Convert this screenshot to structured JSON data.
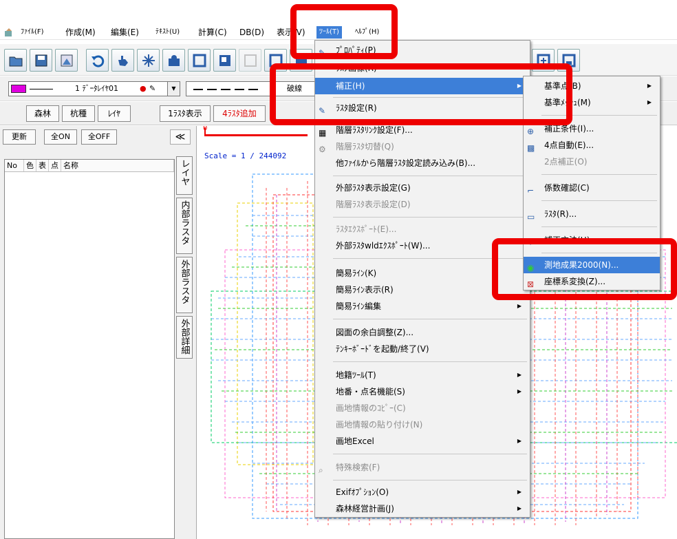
{
  "menubar": {
    "items": [
      "ﾌｧｲﾙ(F)",
      "作成(M)",
      "編集(E)",
      "ﾃｷｽﾄ(U)",
      "計算(C)",
      "DB(D)",
      "表示(V)",
      "ﾂｰﾙ(T)",
      "ﾍﾙﾌﾟ(H)"
    ]
  },
  "toolbar2": {
    "layer_combo": "1 ﾃﾞｰﾀﾚｲﾔ01",
    "linetype_combo": "破線"
  },
  "toolbar3": {
    "buttons": [
      "森林",
      "杭種",
      "ﾚｲﾔ",
      "1ﾗｽﾀ表示",
      "4ﾗｽﾀ追加"
    ]
  },
  "left_panel": {
    "buttons": [
      "更新",
      "全ON",
      "全OFF"
    ],
    "collapse_label": "≪",
    "columns": [
      "No",
      "色",
      "表",
      "点",
      "名称"
    ],
    "vertical_tabs": [
      "レイヤ",
      "内部ラスタ",
      "外部ラスタ",
      "外部詳細"
    ]
  },
  "canvas": {
    "scale_zero": "0",
    "scale_text": "Scale = 1 / 244092"
  },
  "tools_menu": {
    "items": [
      {
        "label": "ﾌﾟﾛﾊﾟﾃｨ(P)",
        "disabled": false,
        "submenu": false
      },
      {
        "label": "ﾗｽﾀ画像(R)",
        "disabled": false,
        "submenu": false
      },
      {
        "label": "補正(H)",
        "disabled": false,
        "submenu": true,
        "highlighted": true
      },
      {
        "label": "ﾗｽﾀ設定(R)",
        "disabled": false,
        "submenu": false
      },
      {
        "label": "階層ﾗｽﾀﾘﾝｸ設定(F)...",
        "disabled": false,
        "submenu": false
      },
      {
        "label": "階層ﾗｽﾀ切替(Q)",
        "disabled": true,
        "submenu": false
      },
      {
        "label": "他ﾌｧｲﾙから階層ﾗｽﾀ設定読み込み(B)...",
        "disabled": false,
        "submenu": false
      },
      {
        "label": "外部ﾗｽﾀ表示設定(G)",
        "disabled": false,
        "submenu": false
      },
      {
        "label": "階層ﾗｽﾀ表示設定(D)",
        "disabled": true,
        "submenu": false
      },
      {
        "label": "ﾗｽﾀｴｸｽﾎﾟｰﾄ(E)...",
        "disabled": true,
        "submenu": false
      },
      {
        "label": "外部ﾗｽﾀwldｴｸｽﾎﾟｰﾄ(W)...",
        "disabled": false,
        "submenu": false
      },
      {
        "label": "簡易ﾗｲﾝ(K)",
        "disabled": false,
        "submenu": false
      },
      {
        "label": "簡易ﾗｲﾝ表示(R)",
        "disabled": false,
        "submenu": false
      },
      {
        "label": "簡易ﾗｲﾝ編集",
        "disabled": false,
        "submenu": true
      },
      {
        "label": "図面の余白調整(Z)...",
        "disabled": false,
        "submenu": false
      },
      {
        "label": "ﾃﾝｷｰﾎﾞｰﾄﾞを起動/終了(V)",
        "disabled": false,
        "submenu": false
      },
      {
        "label": "地籍ﾂｰﾙ(T)",
        "disabled": false,
        "submenu": true
      },
      {
        "label": "地番・点名機能(S)",
        "disabled": false,
        "submenu": true
      },
      {
        "label": "画地情報のｺﾋﾟｰ(C)",
        "disabled": true,
        "submenu": false
      },
      {
        "label": "画地情報の貼り付け(N)",
        "disabled": true,
        "submenu": false
      },
      {
        "label": "画地Excel",
        "disabled": false,
        "submenu": true
      },
      {
        "label": "特殊検索(F)",
        "disabled": true,
        "submenu": false
      },
      {
        "label": "Exifｵﾌﾟｼｮﾝ(O)",
        "disabled": false,
        "submenu": true
      },
      {
        "label": "森林経営計画(J)",
        "disabled": false,
        "submenu": true
      }
    ]
  },
  "correction_submenu": {
    "items": [
      {
        "label": "基準点(B)",
        "disabled": false,
        "submenu": true
      },
      {
        "label": "基準ﾒｯｼｭ(M)",
        "disabled": false,
        "submenu": true
      },
      {
        "label": "補正条件(I)...",
        "disabled": false,
        "submenu": false
      },
      {
        "label": "4点自動(E)...",
        "disabled": false,
        "submenu": false
      },
      {
        "label": "2点補正(O)",
        "disabled": true,
        "submenu": false
      },
      {
        "label": "係数確認(C)",
        "disabled": false,
        "submenu": false
      },
      {
        "label": "ﾗｽﾀ(R)...",
        "disabled": false,
        "submenu": false
      },
      {
        "label": "補正方法(H)",
        "disabled": false,
        "submenu": false
      },
      {
        "label": "測地成果2000(N)...",
        "disabled": false,
        "submenu": false,
        "highlighted": true
      },
      {
        "label": "座標系変換(Z)...",
        "disabled": false,
        "submenu": false
      }
    ]
  },
  "colors": {
    "highlight": "#3d7fd8",
    "annotation": "#ee0000",
    "scale": "#e00000"
  }
}
